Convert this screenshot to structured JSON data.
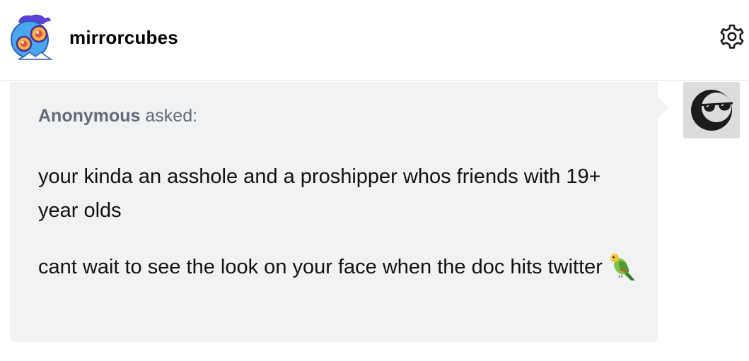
{
  "header": {
    "blog_name": "mirrorcubes",
    "avatar_icon": "blog-avatar-cartoon-icon",
    "settings_icon": "gear-icon"
  },
  "ask": {
    "asker_name": "Anonymous",
    "asked_label": "asked:",
    "asker_avatar_icon": "anonymous-sunglasses-icon",
    "paragraph_1": "your kinda an asshole and a proshipper whos friends with 19+ year olds",
    "paragraph_2": "cant wait to see the look on your face when the doc hits twitter",
    "emoji": "parrot-emoji",
    "colors": {
      "bubble_background": "#f1f2f4",
      "asker_text": "#636b79"
    }
  }
}
